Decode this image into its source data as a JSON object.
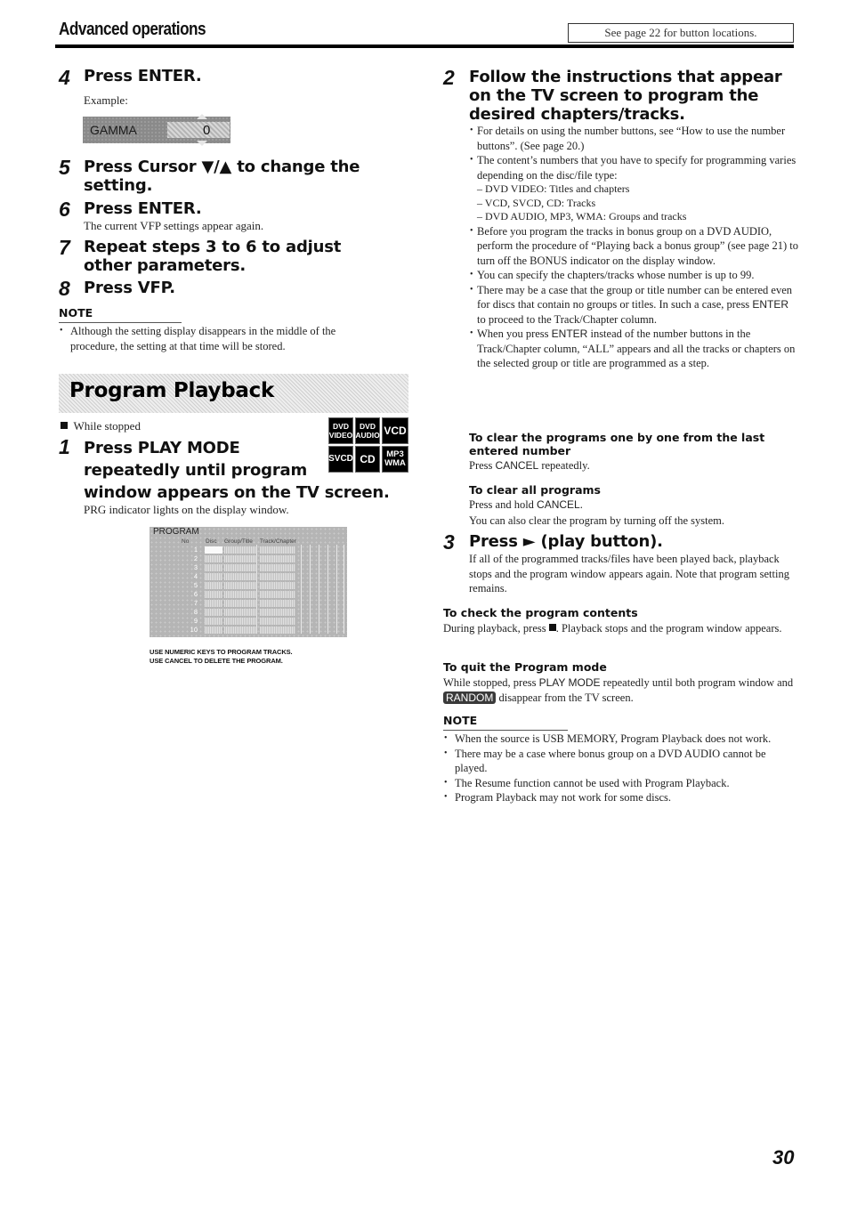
{
  "header": {
    "section_title": "Advanced operations",
    "button_ref": "See page 22 for button locations."
  },
  "left": {
    "step4": {
      "num": "4",
      "heading": "Press ENTER.",
      "example_label": "Example:"
    },
    "gamma_display": {
      "label": "GAMMA",
      "value": "0"
    },
    "step5": {
      "num": "5",
      "heading_pre": "Press Cursor ",
      "arrows": "▼/▲",
      "heading_post": " to change the setting."
    },
    "step6": {
      "num": "6",
      "heading": "Press ENTER.",
      "body": "The current VFP settings appear again."
    },
    "step7": {
      "num": "7",
      "heading": "Repeat steps 3 to 6 to adjust other parameters."
    },
    "step8": {
      "num": "8",
      "heading": "Press VFP."
    },
    "note": {
      "title": "NOTE",
      "items": [
        "Although the setting display disappears in the middle of the procedure, the setting at that time will be stored."
      ]
    },
    "section_banner": "Program Playback",
    "condition": "While stopped",
    "step1": {
      "num": "1",
      "heading_line1": "Press PLAY MODE",
      "heading_line2": "repeatedly until program",
      "heading_line3": "window appears on the TV screen.",
      "body": "PRG indicator lights on the display window."
    },
    "disc_badges": [
      {
        "line1": "DVD",
        "line2": "VIDEO"
      },
      {
        "line1": "DVD",
        "line2": "AUDIO"
      },
      {
        "line1": "VCD",
        "line2": ""
      },
      {
        "line1": "SVCD",
        "line2": ""
      },
      {
        "line1": "CD",
        "line2": ""
      },
      {
        "line1": "MP3",
        "line2": "WMA"
      }
    ],
    "program_screen": {
      "title": "PROGRAM",
      "columns": [
        "No",
        "Disc",
        "Group/Title",
        "Track/Chapter"
      ],
      "rows": [
        "1",
        "2",
        "3",
        "4",
        "5",
        "6",
        "7",
        "8",
        "9",
        "10"
      ],
      "caption_line1": "USE NUMERIC KEYS TO PROGRAM TRACKS.",
      "caption_line2": "USE CANCEL TO DELETE THE PROGRAM."
    }
  },
  "right": {
    "step2": {
      "num": "2",
      "heading": "Follow the instructions that appear on the TV screen to program the desired chapters/tracks.",
      "bullets": [
        "For details on using the number buttons, see “How to use the number buttons”. (See page 20.)",
        "The content’s numbers that you have to specify for programming varies depending on the disc/file type:",
        "Before you program the tracks in bonus group on a DVD AUDIO, perform the procedure of “Playing back a bonus group” (see page 21) to turn off the BONUS indicator on the display window.",
        "You can specify the chapters/tracks whose number is up to 99.",
        "There may be a case that the group or title number can be entered even for discs that contain no groups or titles. In such a case, press ",
        "When you press "
      ],
      "bullet5_key": "ENTER",
      "bullet5_post": " to proceed to the Track/Chapter column.",
      "bullet6_key": "ENTER",
      "bullet6_post": " instead of the number buttons in the Track/Chapter column, “ALL” appears and all the tracks or chapters on the selected group or title are programmed as a step.",
      "disc_types": [
        "– DVD VIDEO: Titles and chapters",
        "– VCD, SVCD, CD: Tracks",
        "– DVD AUDIO, MP3, WMA: Groups and tracks"
      ]
    },
    "clear_one": {
      "title": "To clear the programs one by one from the last entered number",
      "pre": "Press ",
      "key": "CANCEL",
      "post": " repeatedly."
    },
    "clear_all": {
      "title": "To clear all programs",
      "pre": "Press and hold ",
      "key": "CANCEL",
      "post": ".",
      "body2": "You can also clear the program by turning off the system."
    },
    "step3": {
      "num": "3",
      "heading_pre": "Press ",
      "play_icon": "►",
      "heading_post": " (play button).",
      "body": "If all of the programmed tracks/files have been played back, playback stops and the program window appears again. Note that program setting remains."
    },
    "check_contents": {
      "title": "To check the program contents",
      "pre": "During playback, press ",
      "post": ". Playback stops and the program window appears."
    },
    "quit_mode": {
      "title": "To quit the Program mode",
      "pre": "While stopped, press ",
      "key": "PLAY MODE",
      "mid": " repeatedly until both program window and ",
      "badge": "RANDOM",
      "post": " disappear from the TV screen."
    },
    "note": {
      "title": "NOTE",
      "items": [
        "When the source is USB MEMORY, Program Playback does not work.",
        "There may be a case where bonus group on a DVD AUDIO cannot be played.",
        "The Resume function cannot be used with Program Playback.",
        "Program Playback may not work for some discs."
      ]
    }
  },
  "page_number": "30"
}
